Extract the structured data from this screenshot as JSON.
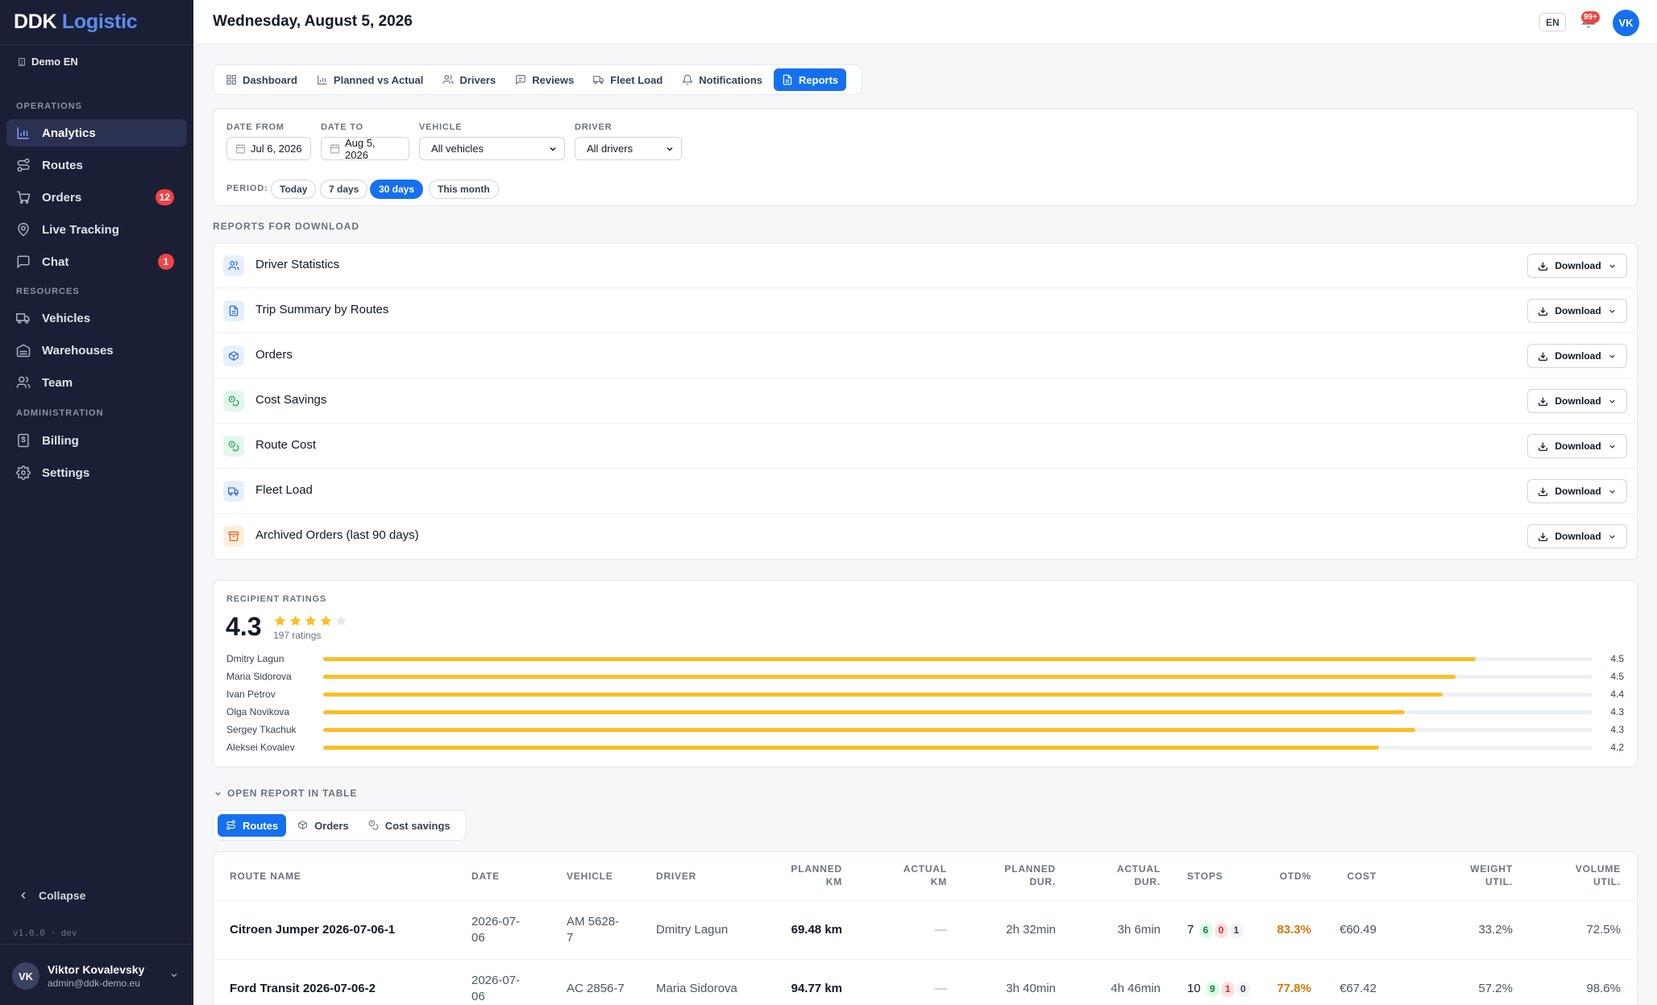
{
  "sidebar": {
    "brand_part1": "DDK",
    "brand_part2": "Logistic",
    "org": "Demo EN",
    "sections": {
      "operations": "OPERATIONS",
      "resources": "RESOURCES",
      "administration": "ADMINISTRATION"
    },
    "items": [
      {
        "label": "Analytics",
        "icon": "bar-chart-icon",
        "active": true
      },
      {
        "label": "Routes",
        "icon": "route-icon"
      },
      {
        "label": "Orders",
        "icon": "cart-icon",
        "badge": "12"
      },
      {
        "label": "Live Tracking",
        "icon": "map-pin-icon"
      },
      {
        "label": "Chat",
        "icon": "chat-icon",
        "badge": "1"
      },
      {
        "label": "Vehicles",
        "icon": "truck-icon"
      },
      {
        "label": "Warehouses",
        "icon": "warehouse-icon"
      },
      {
        "label": "Team",
        "icon": "users-icon"
      },
      {
        "label": "Billing",
        "icon": "receipt-icon"
      },
      {
        "label": "Settings",
        "icon": "gear-icon"
      }
    ],
    "collapse": "Collapse",
    "version": "v1.0.0 · dev",
    "user": {
      "initials": "VK",
      "name": "Viktor Kovalevsky",
      "email": "admin@ddk-demo.eu"
    }
  },
  "header": {
    "date": "Wednesday, August 5, 2026",
    "lang": "EN",
    "notif_badge": "99+",
    "avatar": "VK"
  },
  "tabs": [
    {
      "label": "Dashboard",
      "icon": "grid-icon"
    },
    {
      "label": "Planned vs Actual",
      "icon": "bar-chart-icon"
    },
    {
      "label": "Drivers",
      "icon": "users-icon"
    },
    {
      "label": "Reviews",
      "icon": "message-icon"
    },
    {
      "label": "Fleet Load",
      "icon": "truck-icon"
    },
    {
      "label": "Notifications",
      "icon": "bell-icon"
    },
    {
      "label": "Reports",
      "icon": "file-icon",
      "active": true
    }
  ],
  "filters": {
    "date_from_label": "DATE FROM",
    "date_from": "Jul 6, 2026",
    "date_to_label": "DATE TO",
    "date_to": "Aug 5, 2026",
    "vehicle_label": "VEHICLE",
    "vehicle": "All vehicles",
    "driver_label": "DRIVER",
    "driver": "All drivers",
    "period_label": "PERIOD:",
    "periods": [
      "Today",
      "7 days",
      "30 days",
      "This month"
    ],
    "active_period": "30 days"
  },
  "reports": {
    "title": "REPORTS FOR DOWNLOAD",
    "download_label": "Download",
    "items": [
      {
        "name": "Driver Statistics",
        "icon": "users-icon",
        "color": "blue"
      },
      {
        "name": "Trip Summary by Routes",
        "icon": "file-icon",
        "color": "blue"
      },
      {
        "name": "Orders",
        "icon": "box-icon",
        "color": "blue"
      },
      {
        "name": "Cost Savings",
        "icon": "coins-icon",
        "color": "green"
      },
      {
        "name": "Route Cost",
        "icon": "coins-icon",
        "color": "green"
      },
      {
        "name": "Fleet Load",
        "icon": "truck-icon",
        "color": "blue"
      },
      {
        "name": "Archived Orders (last 90 days)",
        "icon": "archive-icon",
        "color": "orange"
      }
    ]
  },
  "ratings": {
    "title": "RECIPIENT RATINGS",
    "average": "4.3",
    "stars_filled": 4,
    "stars_total": 5,
    "count": "197 ratings",
    "drivers": [
      {
        "name": "Dmitry Lagun",
        "value": "4.5",
        "fill": 0.908
      },
      {
        "name": "Maria Sidorova",
        "value": "4.5",
        "fill": 0.892
      },
      {
        "name": "Ivan Petrov",
        "value": "4.4",
        "fill": 0.882
      },
      {
        "name": "Olga Novikova",
        "value": "4.3",
        "fill": 0.852
      },
      {
        "name": "Sergey Tkachuk",
        "value": "4.3",
        "fill": 0.86
      },
      {
        "name": "Aleksei Kovalev",
        "value": "4.2",
        "fill": 0.832
      }
    ],
    "bar_color": "#fbbf24"
  },
  "open_table": {
    "title": "OPEN REPORT IN TABLE",
    "tabs": [
      {
        "label": "Routes",
        "icon": "route-icon",
        "active": true
      },
      {
        "label": "Orders",
        "icon": "box-icon"
      },
      {
        "label": "Cost savings",
        "icon": "coins-icon"
      }
    ]
  },
  "table": {
    "headers": {
      "route": "ROUTE NAME",
      "date": "DATE",
      "vehicle": "VEHICLE",
      "driver": "DRIVER",
      "planned_km": [
        "PLANNED",
        "KM"
      ],
      "actual_km": [
        "ACTUAL",
        "KM"
      ],
      "planned_dur": [
        "PLANNED",
        "DUR."
      ],
      "actual_dur": [
        "ACTUAL",
        "DUR."
      ],
      "stops": "STOPS",
      "otd": "OTD%",
      "cost": "COST",
      "weight": [
        "WEIGHT",
        "UTIL."
      ],
      "volume": [
        "VOLUME",
        "UTIL."
      ]
    },
    "rows": [
      {
        "route": "Citroen Jumper 2026-07-06-1",
        "date": [
          "2026-07-",
          "06"
        ],
        "vehicle": [
          "AM 5628-",
          "7"
        ],
        "driver": "Dmitry Lagun",
        "planned_km": "69.48 km",
        "actual_km": "—",
        "planned_dur": "2h 32min",
        "actual_dur": "3h 6min",
        "stops": "7",
        "stops_ok": "6",
        "stops_fail": "0",
        "stops_other": "1",
        "otd": "83.3%",
        "cost": "€60.49",
        "weight": "33.2%",
        "volume": "72.5%"
      },
      {
        "route": "Ford Transit 2026-07-06-2",
        "date": [
          "2026-07-",
          "06"
        ],
        "vehicle": [
          "AC 2856-7"
        ],
        "driver": "Maria Sidorova",
        "planned_km": "94.77 km",
        "actual_km": "—",
        "planned_dur": "3h 40min",
        "actual_dur": "4h 46min",
        "stops": "10",
        "stops_ok": "9",
        "stops_fail": "1",
        "stops_other": "0",
        "otd": "77.8%",
        "cost": "€67.42",
        "weight": "57.2%",
        "volume": "98.6%"
      }
    ]
  }
}
